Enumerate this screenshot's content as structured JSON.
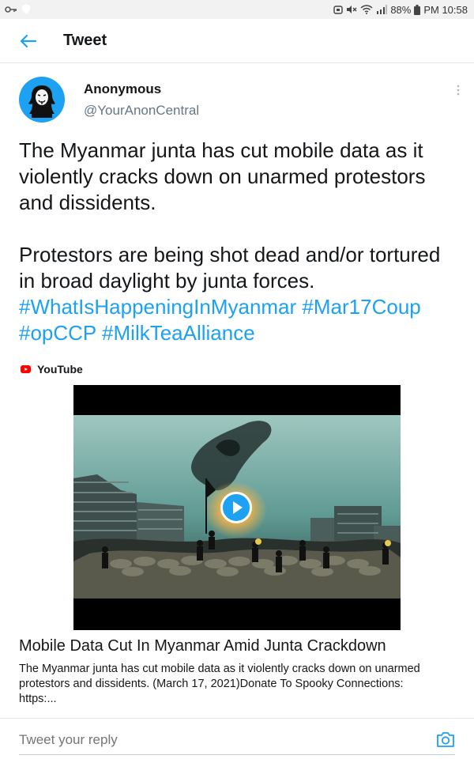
{
  "status_bar": {
    "battery": "88%",
    "time": "PM 10:58",
    "icons": [
      "key-icon",
      "shield-icon",
      "alarm-icon",
      "mute-icon",
      "wifi-icon",
      "signal-icon",
      "battery-icon"
    ]
  },
  "header": {
    "title": "Tweet",
    "back_icon": "back-arrow-icon"
  },
  "author": {
    "name": "Anonymous",
    "handle": "@YourAnonCentral"
  },
  "tweet": {
    "line1": "The Myanmar junta has cut mobile data as it",
    "line2": "violently cracks down on unarmed protestors",
    "line3": "and dissidents.",
    "line4": "Protestors are being shot dead and/or tortured",
    "line5": "in broad daylight by junta forces.",
    "hashtags": {
      "h1": "#WhatIsHappeningInMyanmar",
      "h2": "#Mar17Coup",
      "h3": "#opCCP",
      "h4": "#MilkTeaAlliance"
    }
  },
  "card": {
    "source": "YouTube",
    "title": "Mobile Data Cut In Myanmar Amid Junta Crackdown",
    "description_line1": "The Myanmar junta has cut mobile data as it violently cracks down on unarmed",
    "description_line2": "protestors and dissidents. (March 17, 2021)Donate To Spooky Connections:",
    "description_line3": "https:..."
  },
  "reply": {
    "placeholder": "Tweet your reply"
  },
  "colors": {
    "accent": "#1da1f2",
    "youtube_red": "#ff0000",
    "text": "#14171a",
    "muted": "#657786"
  }
}
